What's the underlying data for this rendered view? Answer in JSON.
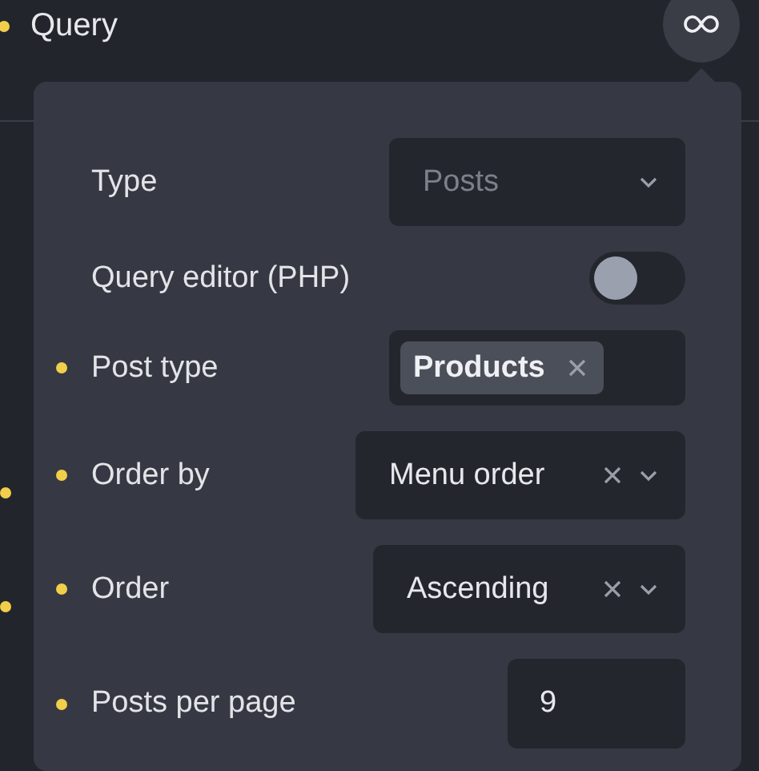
{
  "section": {
    "title": "Query",
    "modified": true
  },
  "outer_rows": [
    {
      "modified": true
    },
    {
      "modified": true
    }
  ],
  "fields": [
    {
      "kind": "select",
      "label": "Type",
      "modified": false,
      "placeholder": "Posts",
      "clearable": false
    },
    {
      "kind": "toggle",
      "label": "Query editor (PHP)",
      "modified": false,
      "on": false
    },
    {
      "kind": "tags",
      "label": "Post type",
      "modified": true,
      "tags": [
        "Products"
      ]
    },
    {
      "kind": "select",
      "label": "Order by",
      "modified": true,
      "value": "Menu order",
      "clearable": true
    },
    {
      "kind": "select",
      "label": "Order",
      "modified": true,
      "value": "Ascending",
      "clearable": true
    },
    {
      "kind": "number",
      "label": "Posts per page",
      "modified": true,
      "value": "9"
    }
  ]
}
